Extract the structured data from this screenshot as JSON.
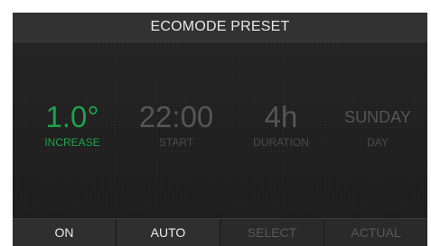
{
  "title": "ECOMODE PRESET",
  "fields": [
    {
      "value": "1.0°",
      "label": "INCREASE"
    },
    {
      "value": "22:00",
      "label": "START"
    },
    {
      "value": "4h",
      "label": "DURATION"
    },
    {
      "value": "SUNDAY",
      "label": "DAY"
    }
  ],
  "softkeys": [
    {
      "label": "ON"
    },
    {
      "label": "AUTO"
    },
    {
      "label": "SELECT"
    },
    {
      "label": "ACTUAL"
    }
  ],
  "colors": {
    "active": "#1fa24a",
    "inactive": "#555555"
  }
}
